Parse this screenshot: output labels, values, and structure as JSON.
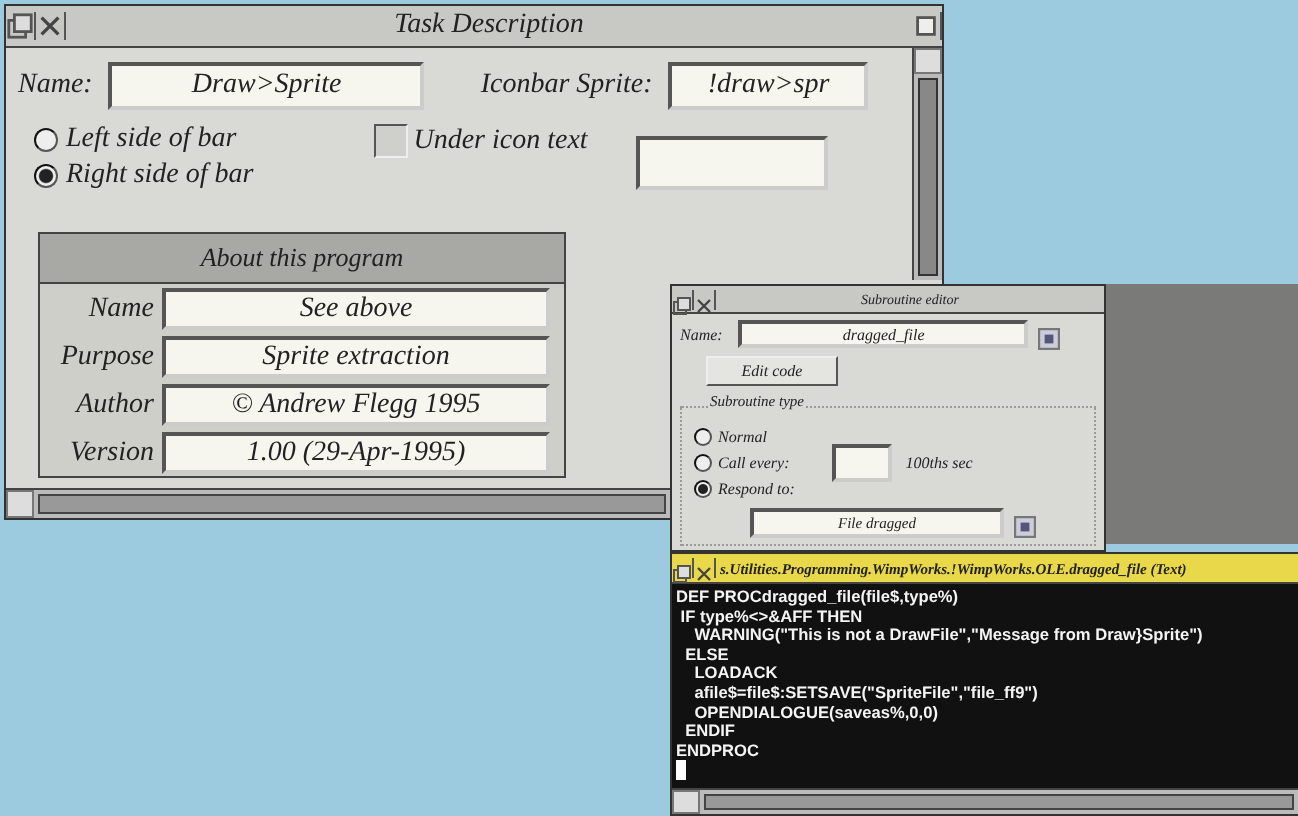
{
  "task_window": {
    "title": "Task Description",
    "name_label": "Name:",
    "name_value": "Draw>Sprite",
    "iconbar_label": "Iconbar Sprite:",
    "iconbar_value": "!draw>spr",
    "position_options": [
      {
        "label": "Left side of bar",
        "selected": false
      },
      {
        "label": "Right side of bar",
        "selected": true
      }
    ],
    "under_icon": {
      "label": "Under icon text",
      "checked": false
    },
    "about": {
      "title": "About this program",
      "rows": [
        {
          "label": "Name",
          "value": "See above"
        },
        {
          "label": "Purpose",
          "value": "Sprite extraction"
        },
        {
          "label": "Author",
          "value": "© Andrew Flegg 1995"
        },
        {
          "label": "Version",
          "value": "1.00 (29-Apr-1995)"
        }
      ]
    }
  },
  "subroutine_window": {
    "title": "Subroutine editor",
    "name_label": "Name:",
    "name_value": "dragged_file",
    "edit_button": "Edit code",
    "group_title": "Subroutine type",
    "type_options": [
      {
        "kind": "plain",
        "label": "Normal",
        "selected": false
      },
      {
        "kind": "interval",
        "label": "Call every:",
        "selected": false,
        "unit": "100ths sec"
      },
      {
        "kind": "plain",
        "label": "Respond to:",
        "selected": true
      }
    ],
    "respond_value": "File dragged"
  },
  "code_window": {
    "title": "s.Utilities.Programming.WimpWorks.!WimpWorks.OLE.dragged_file (Text)",
    "lines": [
      "DEF PROCdragged_file(file$,type%)",
      " IF type%<>&AFF THEN",
      "    WARNING(\"This is not a DrawFile\",\"Message from Draw}Sprite\")",
      "  ELSE",
      "    LOADACK",
      "    afile$=file$:SETSAVE(\"SpriteFile\",\"file_ff9\")",
      "    OPENDIALOGUE(saveas%,0,0)",
      "  ENDIF",
      "ENDPROC"
    ]
  }
}
